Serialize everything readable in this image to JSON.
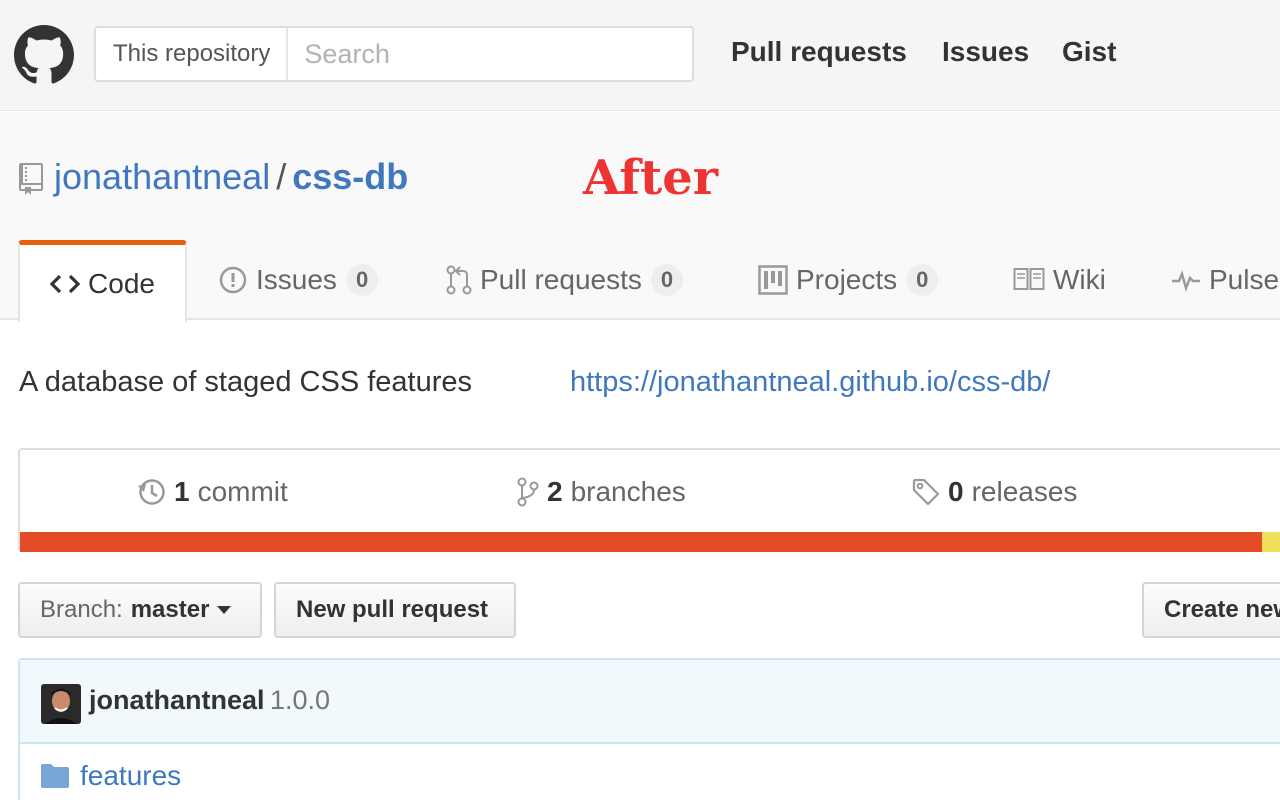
{
  "header": {
    "search_scope": "This repository",
    "search_placeholder": "Search",
    "nav": [
      "Pull requests",
      "Issues",
      "Gist"
    ]
  },
  "repo": {
    "owner": "jonathantneal",
    "separator": "/",
    "name": "css-db",
    "annotation": "After"
  },
  "tabs": [
    {
      "label": "Code",
      "active": true
    },
    {
      "label": "Issues",
      "count": "0"
    },
    {
      "label": "Pull requests",
      "count": "0"
    },
    {
      "label": "Projects",
      "count": "0"
    },
    {
      "label": "Wiki"
    },
    {
      "label": "Pulse"
    }
  ],
  "description": {
    "text": "A database of staged CSS features",
    "homepage": "https://jonathantneal.github.io/css-db/"
  },
  "summary": {
    "commits": {
      "num": "1",
      "label": "commit"
    },
    "branches": {
      "num": "2",
      "label": "branches"
    },
    "releases": {
      "num": "0",
      "label": "releases"
    },
    "languages": [
      {
        "color": "#e34c26",
        "share": 0.97
      },
      {
        "color": "#f1e05a",
        "share": 0.03
      }
    ]
  },
  "toolbar": {
    "branch_prefix": "Branch:",
    "branch_name": "master",
    "new_pr": "New pull request",
    "create_new": "Create new file"
  },
  "commit": {
    "author": "jonathantneal",
    "message": "1.0.0"
  },
  "files": [
    {
      "name": "features",
      "type": "folder"
    }
  ],
  "colors": {
    "link": "#4078c0",
    "active_tab_accent": "#e36209",
    "annotation": "#ee3333"
  }
}
